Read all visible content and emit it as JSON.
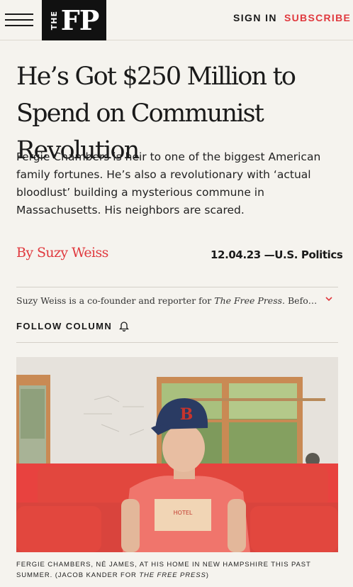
{
  "header": {
    "logo_the": "THE",
    "logo_fp": "FP",
    "sign_in": "SIGN IN",
    "subscribe": "SUBSCRIBE"
  },
  "article": {
    "headline": "He’s Got $250 Million to Spend on Communist Revolution",
    "dek": "Fergie Chambers is heir to one of the biggest American family fortunes. He’s also a revolutionary with ‘actual bloodlust’ building a mysterious commune in Massachusetts. His neighbors are scared.",
    "byline_prefix": "By ",
    "author": "Suzy Weiss",
    "date": "12.04.23",
    "separator": " —",
    "section": "U.S. Politics",
    "bio_part1": "Suzy Weiss is a co-founder and reporter for ",
    "bio_publication": "The Free Press",
    "bio_part2": ". Before that she was a staff writer...",
    "follow_label": "FOLLOW COLUMN",
    "caption_part1": "FERGIE CHAMBERS, NÉ JAMES, AT HIS HOME IN NEW HAMPSHIRE THIS PAST SUMMER. (JACOB KANDER FOR ",
    "caption_publication": "THE FREE PRESS",
    "caption_part2": ")"
  },
  "icons": {
    "menu": "hamburger-menu-icon",
    "bell": "bell-icon",
    "chevron": "chevron-down-icon"
  },
  "colors": {
    "background": "#f5f3ee",
    "accent": "#e0393e",
    "text": "#1a1a1a",
    "logo_bg": "#111111"
  }
}
